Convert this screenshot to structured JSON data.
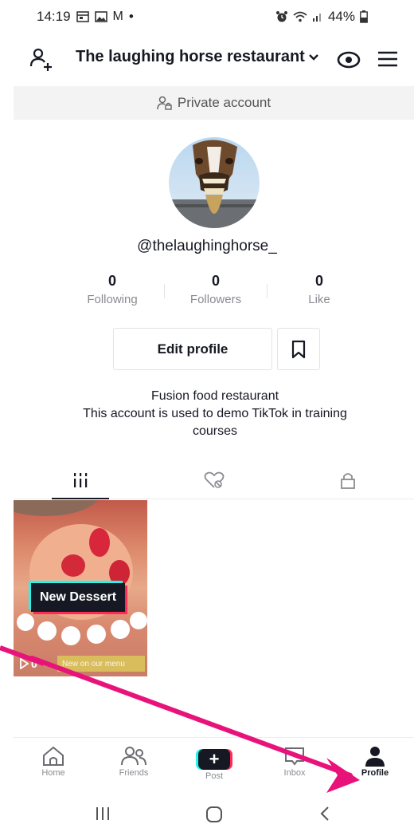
{
  "status_bar": {
    "time": "14:19",
    "mail_glyph": "M",
    "dot": "•",
    "battery": "44%"
  },
  "header": {
    "title": "The laughing horse restaurant"
  },
  "private_banner": {
    "text": "Private account"
  },
  "profile": {
    "username": "@thelaughinghorse_",
    "stats": [
      {
        "value": "0",
        "label": "Following"
      },
      {
        "value": "0",
        "label": "Followers"
      },
      {
        "value": "0",
        "label": "Like"
      }
    ],
    "edit_button": "Edit profile",
    "bio_lines": [
      "Fusion food restaurant",
      "This account is used to demo TikTok in training",
      "courses"
    ]
  },
  "videos": [
    {
      "label": "New Dessert",
      "views": "0",
      "caption": "New on our menu"
    }
  ],
  "bottom_nav": {
    "items": [
      {
        "label": "Home",
        "icon": "home-icon"
      },
      {
        "label": "Friends",
        "icon": "friends-icon"
      },
      {
        "label": "Post",
        "icon": "plus-icon"
      },
      {
        "label": "Inbox",
        "icon": "inbox-icon"
      },
      {
        "label": "Profile",
        "icon": "profile-icon"
      }
    ],
    "post_plus": "+"
  },
  "colors": {
    "accent_pink": "#fe2c55",
    "accent_cyan": "#25f4ee",
    "arrow": "#e8137a",
    "text_primary": "#161823",
    "text_secondary": "#8a8b91"
  }
}
